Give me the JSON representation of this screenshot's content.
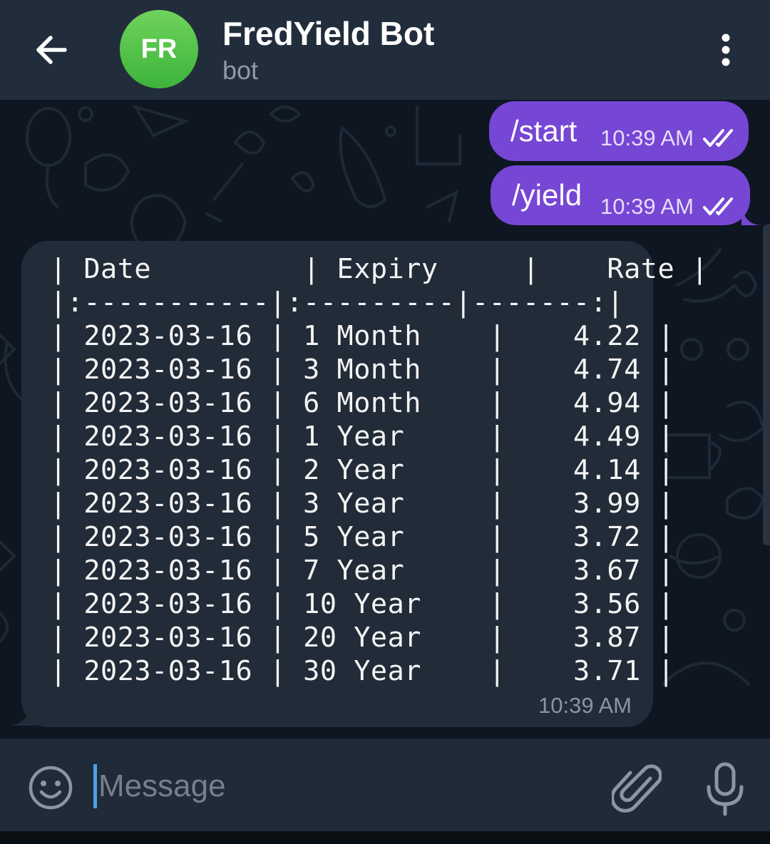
{
  "header": {
    "avatar_initials": "FR",
    "title": "FredYield Bot",
    "subtitle": "bot",
    "accent_color": "#212d3b"
  },
  "messages": {
    "outgoing": [
      {
        "text": "/start",
        "time": "10:39 AM",
        "status": "read"
      },
      {
        "text": "/yield",
        "time": "10:39 AM",
        "status": "read"
      }
    ],
    "incoming": {
      "time": "10:39 AM",
      "table_lines": [
        "| Date         | Expiry     |    Rate |",
        "|:-----------|:---------|-------:|",
        "| 2023-03-16 | 1 Month    |    4.22 |",
        "| 2023-03-16 | 3 Month    |    4.74 |",
        "| 2023-03-16 | 6 Month    |    4.94 |",
        "| 2023-03-16 | 1 Year     |    4.49 |",
        "| 2023-03-16 | 2 Year     |    4.14 |",
        "| 2023-03-16 | 3 Year     |    3.99 |",
        "| 2023-03-16 | 5 Year     |    3.72 |",
        "| 2023-03-16 | 7 Year     |    3.67 |",
        "| 2023-03-16 | 10 Year    |    3.56 |",
        "| 2023-03-16 | 20 Year    |    3.87 |",
        "| 2023-03-16 | 30 Year    |    3.71 |"
      ]
    },
    "outgoing_color": "#7646d4",
    "incoming_color": "#222c38"
  },
  "composer": {
    "placeholder": "Message"
  },
  "icons": {
    "back": "arrow-left-icon",
    "menu": "more-vertical-icon",
    "emoji": "smile-icon",
    "attach": "paperclip-icon",
    "mic": "microphone-icon",
    "read": "double-check-icon"
  }
}
